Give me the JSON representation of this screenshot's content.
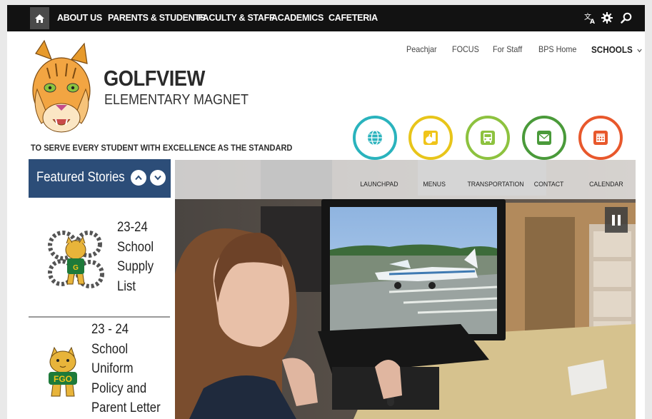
{
  "nav": {
    "home_icon": "home-icon",
    "items": [
      "ABOUT US",
      "PARENTS & STUDENTS",
      "FACULTY & STAFF",
      "ACADEMICS",
      "CAFETERIA"
    ],
    "utility_icons": [
      "translate-icon",
      "gear-icon",
      "search-icon"
    ]
  },
  "header": {
    "name": "GOLFVIEW",
    "subtitle": "ELEMENTARY MAGNET",
    "tagline": "TO SERVE EVERY STUDENT WITH EXCELLENCE AS THE STANDARD"
  },
  "quick_links": [
    "Peachjar",
    "FOCUS",
    "For Staff",
    "BPS Home"
  ],
  "schools_label": "SCHOOLS",
  "icons": [
    {
      "label": "LAUNCHPAD",
      "color": "#2ab3bd",
      "icon": "globe-icon"
    },
    {
      "label": "MENUS",
      "color": "#e8c51a",
      "icon": "apple-icon"
    },
    {
      "label": "TRANSPORTATION",
      "color": "#8dc23f",
      "icon": "bus-icon"
    },
    {
      "label": "CONTACT",
      "color": "#4a9a3a",
      "icon": "envelope-icon"
    },
    {
      "label": "CALENDAR",
      "color": "#e8582c",
      "icon": "calendar-icon"
    }
  ],
  "featured": {
    "title": "Featured Stories",
    "stories": [
      {
        "title_lines": [
          "23-24",
          "School",
          "Supply",
          "List"
        ]
      },
      {
        "title_lines": [
          "23 - 24",
          "School",
          "Uniform",
          "Policy and",
          "Parent Letter"
        ]
      }
    ]
  },
  "colors": {
    "nav_bg": "#121212",
    "featured_bg": "#2c4d78"
  }
}
